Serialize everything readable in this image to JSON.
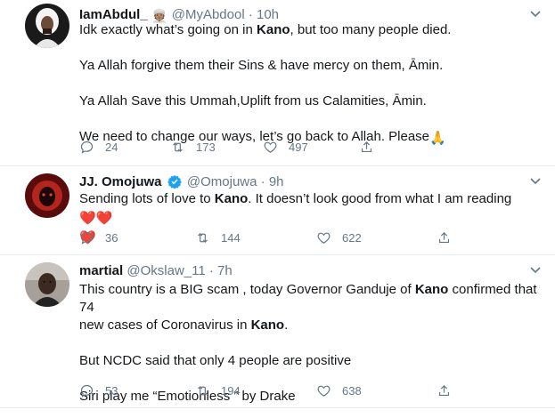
{
  "tweets": [
    {
      "name": "IamAbdul_",
      "name_emoji": "👳🏽",
      "handle": "@MyAbdool",
      "separator": "·",
      "time": "10h",
      "lines": [
        [
          "Idk exactly what’s going on in ",
          "Kano",
          ", but too many people died."
        ],
        [
          "Ya Allah forgive them their Sins & have mercy on them, Āmin."
        ],
        [
          "Ya Allah Save this Ummah,Uplift from us Calamities, Āmin."
        ],
        [
          "We need to change our ways, let’s go back to Allah. Please"
        ]
      ],
      "line4_emoji": "🙏",
      "replies": "24",
      "retweets": "173",
      "likes": "497"
    },
    {
      "name": "JJ. Omojuwa",
      "handle": "@Omojuwa",
      "separator": "·",
      "time": "9h",
      "text_pre": "Sending lots of love to ",
      "text_bold": "Kano",
      "text_post": ". It doesn’t look good from what I am reading ",
      "hearts": "❤️❤️",
      "heart_wrap": "❤️",
      "replies": "36",
      "retweets": "144",
      "likes": "622"
    },
    {
      "name": "martial",
      "handle": "@Okslaw_11",
      "separator": "·",
      "time": "7h",
      "l1_pre": "This country is a BIG scam , today Governor Ganduje of ",
      "l1_bold": "Kano",
      "l1_post": " confirmed that 74",
      "l2_pre": "new cases of Coronavirus in ",
      "l2_bold": "Kano",
      "l2_post": ".",
      "l3": "But NCDC said that only 4 people are positive",
      "l4": "Siri play me “Emotionless ” by Drake",
      "replies": "53",
      "retweets": "194",
      "likes": "638"
    }
  ],
  "icons": {
    "reply": "reply-icon",
    "retweet": "retweet-icon",
    "like": "like-icon",
    "share": "share-icon",
    "caret": "chevron-down-icon",
    "verified": "verified-badge-icon"
  },
  "colors": {
    "text": "#14171a",
    "muted": "#657786",
    "divider": "#e6ecf0",
    "verified": "#1da1f2",
    "heart": "#e0245e"
  }
}
